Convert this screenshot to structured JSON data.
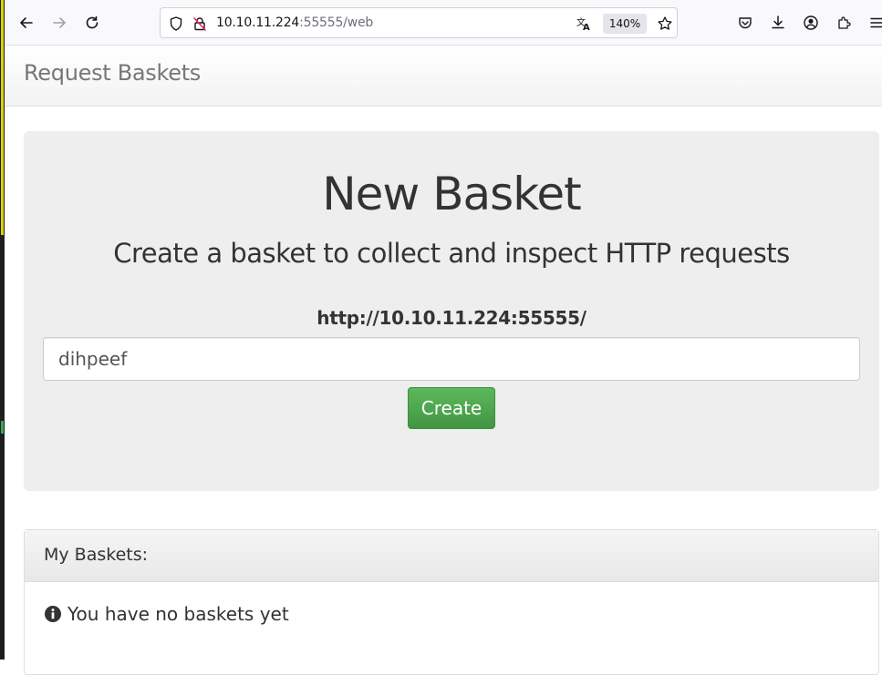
{
  "browser": {
    "url_host": "10.10.11.224",
    "url_rest": ":55555/web",
    "zoom": "140%"
  },
  "app": {
    "brand": "Request Baskets"
  },
  "new_basket": {
    "title": "New Basket",
    "subtitle": "Create a basket to collect and inspect HTTP requests",
    "base_url": "http://10.10.11.224:55555/",
    "input_value": "dihpeef",
    "create_label": "Create"
  },
  "my_baskets": {
    "title": "My Baskets:",
    "empty_message": "You have no baskets yet"
  },
  "icons": {
    "back": "arrow-left-icon",
    "forward": "arrow-right-icon",
    "reload": "reload-icon",
    "shield": "shield-icon",
    "insecure": "insecure-lock-icon",
    "translate": "translate-icon",
    "bookmark": "star-icon",
    "pocket": "pocket-icon",
    "downloads": "download-icon",
    "account": "account-icon",
    "extensions": "extensions-icon",
    "menu": "hamburger-menu-icon",
    "info": "info-circle-icon"
  },
  "colors": {
    "create_button": "#5cb85c",
    "jumbotron_bg": "#eeeeee",
    "brand_text": "#777777"
  }
}
